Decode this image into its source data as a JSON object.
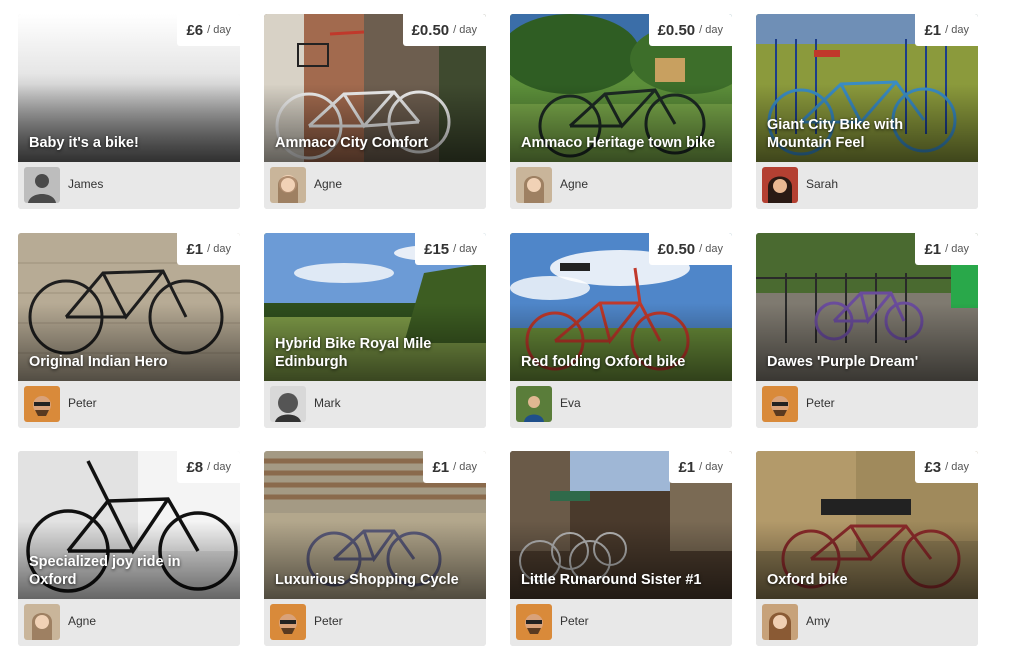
{
  "price_unit": "/ day",
  "listings": [
    {
      "title": "Baby it's a bike!",
      "price": "£6",
      "owner": "James"
    },
    {
      "title": "Ammaco City Comfort",
      "price": "£0.50",
      "owner": "Agne"
    },
    {
      "title": "Ammaco Heritage town bike",
      "price": "£0.50",
      "owner": "Agne"
    },
    {
      "title": "Giant City Bike with Mountain Feel",
      "price": "£1",
      "owner": "Sarah"
    },
    {
      "title": "Original Indian Hero",
      "price": "£1",
      "owner": "Peter"
    },
    {
      "title": "Hybrid Bike Royal Mile Edinburgh",
      "price": "£15",
      "owner": "Mark"
    },
    {
      "title": "Red folding Oxford bike",
      "price": "£0.50",
      "owner": "Eva"
    },
    {
      "title": "Dawes 'Purple Dream'",
      "price": "£1",
      "owner": "Peter"
    },
    {
      "title": "Specialized joy ride in Oxford",
      "price": "£8",
      "owner": "Agne"
    },
    {
      "title": "Luxurious Shopping Cycle",
      "price": "£1",
      "owner": "Peter"
    },
    {
      "title": "Little Runaround Sister #1",
      "price": "£1",
      "owner": "Peter"
    },
    {
      "title": "Oxford bike",
      "price": "£3",
      "owner": "Amy"
    }
  ],
  "palette": {
    "card_footer": "#e8e8e8",
    "title_text": "#ffffff",
    "price_text": "#333333",
    "owner_text": "#333333"
  }
}
